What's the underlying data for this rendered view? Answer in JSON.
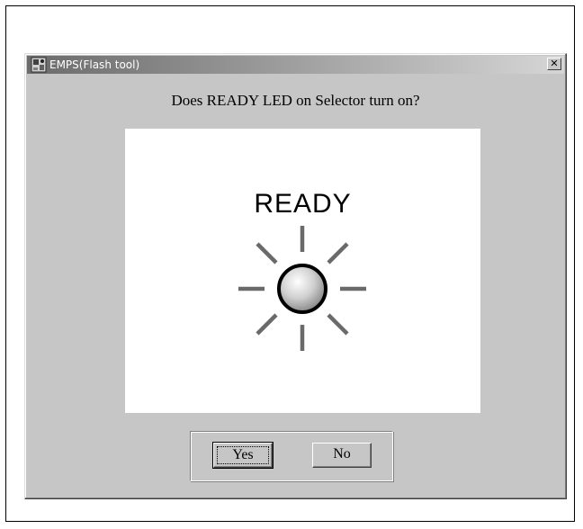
{
  "window": {
    "title": "EMPS(Flash tool)",
    "close_glyph": "✕",
    "app_icon": "app-icon"
  },
  "dialog": {
    "question": "Does READY LED on Selector turn on?",
    "led_label": "READY",
    "led_state": "on",
    "led_icon": "led-lit-icon"
  },
  "buttons": {
    "yes_label": "Yes",
    "no_label": "No",
    "default": "Yes"
  },
  "colors": {
    "dialog_face": "#c6c6c6",
    "titlebar_start": "#6b6b6b",
    "titlebar_end": "#d6d6d6",
    "led_rays": "#6a6a6a"
  }
}
